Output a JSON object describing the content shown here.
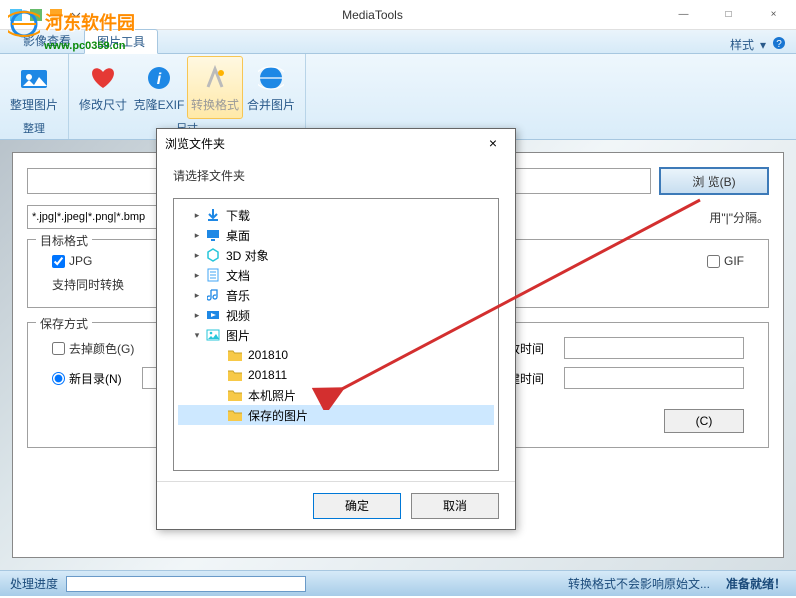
{
  "window": {
    "title": "MediaTools",
    "minimize": "—",
    "maximize": "□",
    "close": "×"
  },
  "watermark": {
    "text": "河东软件园",
    "url": "www.pc0359.cn"
  },
  "ribbon": {
    "tabs": {
      "view": "影像查看",
      "tools": "图片工具"
    },
    "style_menu": "样式",
    "buttons": {
      "organize": "整理图片",
      "resize": "修改尺寸",
      "clone_exif": "克隆EXIF",
      "convert": "转换格式",
      "merge": "合并图片"
    },
    "groups": {
      "organize": "整理",
      "size": "尺寸"
    }
  },
  "form": {
    "browse_btn": "浏 览(B)",
    "filter_value": "*.jpg|*.jpeg|*.png|*.bmp",
    "filter_hint_suffix": "用\"|\"分隔。",
    "target_format_legend": "目标格式",
    "formats": {
      "jpg": "JPG",
      "gif": "GIF"
    },
    "multi_note_prefix": "支持同时转换",
    "save_legend": "保存方式",
    "remove_color": "去掉颜色(G)",
    "new_dir": "新目录(N)",
    "modify_time_suffix": "改时间",
    "build_time_suffix": "建时间",
    "clear_btn": "(C)"
  },
  "statusbar": {
    "progress_label": "处理进度",
    "message": "转换格式不会影响原始文...",
    "ready": "准备就绪！"
  },
  "dialog": {
    "title": "浏览文件夹",
    "hint": "请选择文件夹",
    "close": "×",
    "ok": "确定",
    "cancel": "取消",
    "tree": [
      {
        "label": "下载",
        "level": 1,
        "expander": ">",
        "icon": "download",
        "color": "#1e88e5"
      },
      {
        "label": "桌面",
        "level": 1,
        "expander": ">",
        "icon": "desktop",
        "color": "#1e88e5"
      },
      {
        "label": "3D 对象",
        "level": 1,
        "expander": ">",
        "icon": "3d",
        "color": "#26c6da"
      },
      {
        "label": "文档",
        "level": 1,
        "expander": ">",
        "icon": "doc",
        "color": "#42a5f5"
      },
      {
        "label": "音乐",
        "level": 1,
        "expander": ">",
        "icon": "music",
        "color": "#1e88e5"
      },
      {
        "label": "视频",
        "level": 1,
        "expander": ">",
        "icon": "video",
        "color": "#1e88e5"
      },
      {
        "label": "图片",
        "level": 1,
        "expander": "v",
        "icon": "pictures",
        "color": "#26c6da"
      },
      {
        "label": "201810",
        "level": 2,
        "expander": "",
        "icon": "folder",
        "color": "#f7c948"
      },
      {
        "label": "201811",
        "level": 2,
        "expander": "",
        "icon": "folder",
        "color": "#f7c948"
      },
      {
        "label": "本机照片",
        "level": 2,
        "expander": "",
        "icon": "folder",
        "color": "#f7c948"
      },
      {
        "label": "保存的图片",
        "level": 2,
        "expander": "",
        "icon": "folder",
        "color": "#f7c948",
        "selected": true
      }
    ]
  }
}
